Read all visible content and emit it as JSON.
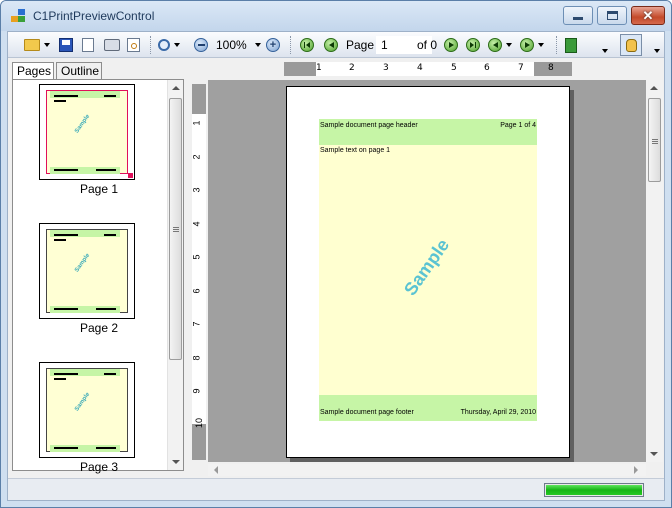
{
  "window": {
    "title": "C1PrintPreviewControl",
    "icon": "app-window-icon",
    "controls": [
      "minimize",
      "maximize",
      "close"
    ]
  },
  "toolbar": {
    "zoom_value": "100%",
    "page_label": "Page",
    "page_value": "1",
    "page_of": "of 0",
    "icons": [
      "open-folder-icon",
      "save-icon",
      "page-setup-icon",
      "print-icon",
      "print-preview-icon",
      "zoom-tool-icon",
      "zoom-out-icon",
      "zoom-in-icon",
      "first-page-icon",
      "previous-page-icon",
      "next-page-icon",
      "last-page-icon",
      "history-back-icon",
      "history-forward-icon",
      "page-view-icon",
      "hand-tool-icon"
    ]
  },
  "left_panel": {
    "tabs": [
      {
        "label": "Pages",
        "active": true
      },
      {
        "label": "Outline",
        "active": false
      }
    ],
    "thumbnails": [
      {
        "label": "Page 1",
        "watermark": "Sample",
        "selected": true
      },
      {
        "label": "Page 2",
        "watermark": "Sample",
        "selected": false
      },
      {
        "label": "Page 3",
        "watermark": "Sample",
        "selected": false
      }
    ]
  },
  "ruler": {
    "horizontal_ticks": [
      "1",
      "2",
      "3",
      "4",
      "5",
      "6",
      "7",
      "8"
    ],
    "vertical_ticks": [
      "1",
      "2",
      "3",
      "4",
      "5",
      "6",
      "7",
      "8",
      "9",
      "10"
    ]
  },
  "document_page": {
    "header_left": "Sample document page header",
    "header_right": "Page 1 of 4",
    "body_text": "Sample text on page 1",
    "watermark": "Sample",
    "footer_left": "Sample document page footer",
    "footer_right": "Thursday, April 29, 2010"
  },
  "status": {
    "progress": 1.0
  },
  "colors": {
    "band": "#c6f5a6",
    "content_bg": "#ffffd0",
    "watermark": "#5ac3d2",
    "progress": "#16b416"
  }
}
